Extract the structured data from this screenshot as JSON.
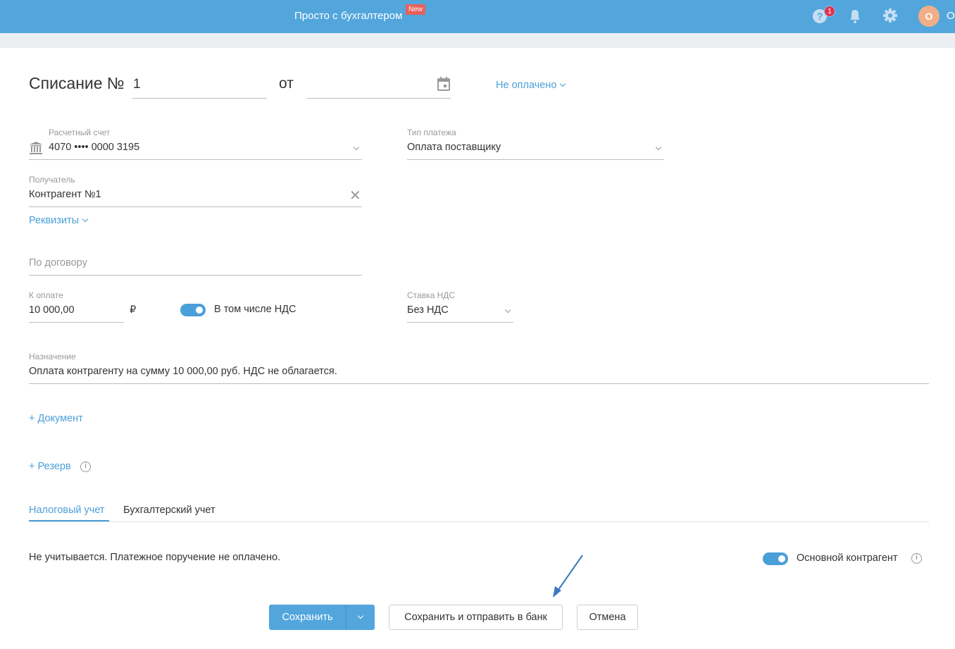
{
  "header": {
    "title": "Просто с бухгалтером",
    "new_badge": "New",
    "help_count": "1",
    "avatar_letter": "О",
    "user_name": "О"
  },
  "form": {
    "title": "Списание №",
    "number": "1",
    "date_label": "от",
    "date_value": "",
    "status": "Не оплачено",
    "account": {
      "label": "Расчетный счет",
      "value": "4070 •••• 0000 3195"
    },
    "payment_type": {
      "label": "Тип платежа",
      "value": "Оплата поставщику"
    },
    "recipient": {
      "label": "Получатель",
      "value": "Контрагент №1"
    },
    "requisites_link": "Реквизиты",
    "contract": {
      "placeholder": "По договору"
    },
    "amount": {
      "label": "К оплате",
      "value": "10 000,00",
      "currency": "₽"
    },
    "vat_toggle": {
      "label": "В том числе НДС",
      "on": true
    },
    "vat_rate": {
      "label": "Ставка НДС",
      "value": "Без НДС"
    },
    "purpose": {
      "label": "Назначение",
      "value": "Оплата контрагенту на сумму 10 000,00 руб. НДС не облагается."
    },
    "add_document": "+ Документ",
    "add_reserve": "+ Резерв",
    "tabs": [
      {
        "label": "Налоговый учет",
        "active": true
      },
      {
        "label": "Бухгалтерский учет",
        "active": false
      }
    ],
    "tax_note": "Не учитывается. Платежное поручение не оплачено.",
    "main_counterparty": {
      "label": "Основной контрагент",
      "on": true
    }
  },
  "buttons": {
    "save": "Сохранить",
    "save_send": "Сохранить и отправить в банк",
    "cancel": "Отмена"
  },
  "colors": {
    "header": "#52a6dc",
    "accent": "#4a9fd8",
    "badge_new": "#e8605c",
    "badge_count": "#e0334f",
    "avatar": "#f2ae87"
  }
}
